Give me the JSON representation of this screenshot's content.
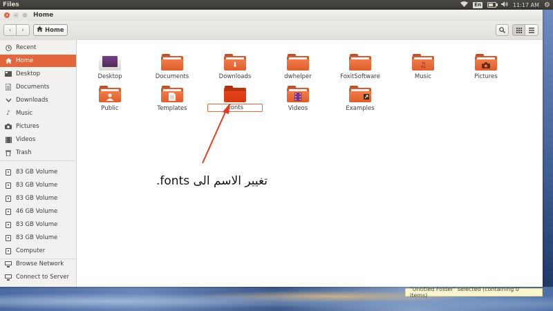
{
  "panel": {
    "app_name": "Files",
    "keyboard_layout": "En",
    "clock": "11:17 AM"
  },
  "window": {
    "title": "Home"
  },
  "toolbar": {
    "path_home_label": "Home"
  },
  "sidebar": {
    "items": [
      {
        "label": "Recent",
        "icon": "clock-icon"
      },
      {
        "label": "Home",
        "icon": "home-icon"
      },
      {
        "label": "Desktop",
        "icon": "desktop-icon"
      },
      {
        "label": "Documents",
        "icon": "documents-icon"
      },
      {
        "label": "Downloads",
        "icon": "download-icon"
      },
      {
        "label": "Music",
        "icon": "music-icon"
      },
      {
        "label": "Pictures",
        "icon": "camera-icon"
      },
      {
        "label": "Videos",
        "icon": "video-icon"
      },
      {
        "label": "Trash",
        "icon": "trash-icon"
      },
      {
        "label": "83 GB Volume",
        "icon": "drive-icon"
      },
      {
        "label": "83 GB Volume",
        "icon": "drive-icon"
      },
      {
        "label": "83 GB Volume",
        "icon": "drive-icon"
      },
      {
        "label": "46 GB Volume",
        "icon": "drive-icon"
      },
      {
        "label": "83 GB Volume",
        "icon": "drive-icon"
      },
      {
        "label": "83 GB Volume",
        "icon": "drive-icon"
      },
      {
        "label": "Computer",
        "icon": "drive-icon"
      },
      {
        "label": "Browse Network",
        "icon": "network-icon"
      },
      {
        "label": "Connect to Server",
        "icon": "server-icon"
      }
    ]
  },
  "folders": {
    "row1": [
      "Desktop",
      "Documents",
      "Downloads",
      "dwhelper",
      "FoxitSoftware",
      "Music",
      "Pictures"
    ],
    "row2": [
      "Public",
      "Templates",
      ".fonts",
      "Videos",
      "Examples"
    ]
  },
  "rename": {
    "value": ".fonts"
  },
  "annotation": {
    "text": "تغيير الاسم الى fonts."
  },
  "status": {
    "text": "\"Untitled Folder\" selected  (containing 0 items)"
  },
  "colors": {
    "accent": "#e3663c",
    "folder_orange": "#e9673a",
    "annotation_arrow": "#e8391c"
  }
}
